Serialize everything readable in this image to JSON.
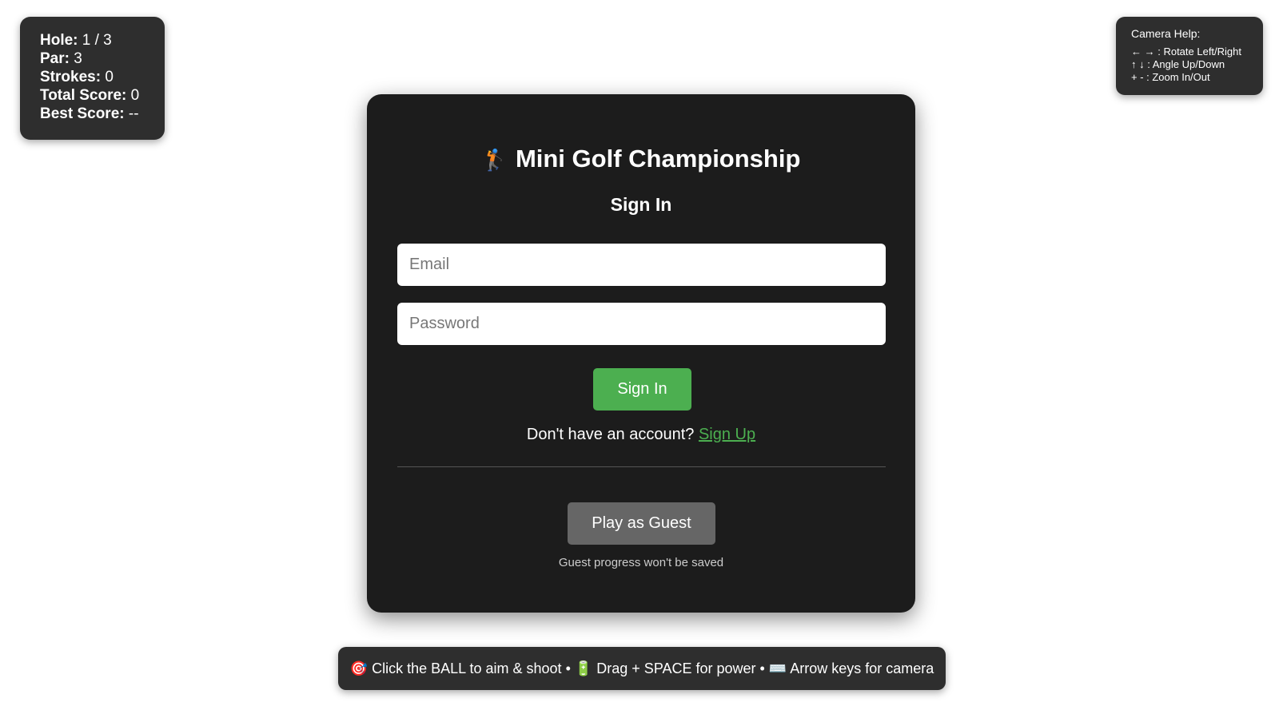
{
  "hud": {
    "hole_label": "Hole:",
    "hole_value": "1 / 3",
    "par_label": "Par:",
    "par_value": "3",
    "strokes_label": "Strokes:",
    "strokes_value": "0",
    "total_label": "Total Score:",
    "total_value": "0",
    "best_label": "Best Score:",
    "best_value": "--"
  },
  "camera_help": {
    "title": "Camera Help:",
    "lines": [
      "← → : Rotate Left/Right",
      "↑ ↓ : Angle Up/Down",
      "+ - : Zoom In/Out"
    ]
  },
  "auth": {
    "golfer_icon": "🏌",
    "title": "Mini Golf Championship",
    "subtitle": "Sign In",
    "email_placeholder": "Email",
    "password_placeholder": "Password",
    "signin_button": "Sign In",
    "signup_prompt": "Don't have an account?",
    "signup_link": "Sign Up",
    "guest_button": "Play as Guest",
    "guest_note": "Guest progress won't be saved"
  },
  "instructions": {
    "text": "🎯 Click the BALL to aim & shoot • 🔋 Drag + SPACE for power • ⌨️ Arrow keys for camera"
  },
  "colors": {
    "accent": "#4caf50",
    "card_bg": "#1c1c1c",
    "panel_bg": "#2e2e2e",
    "guest_button_bg": "#666666"
  }
}
